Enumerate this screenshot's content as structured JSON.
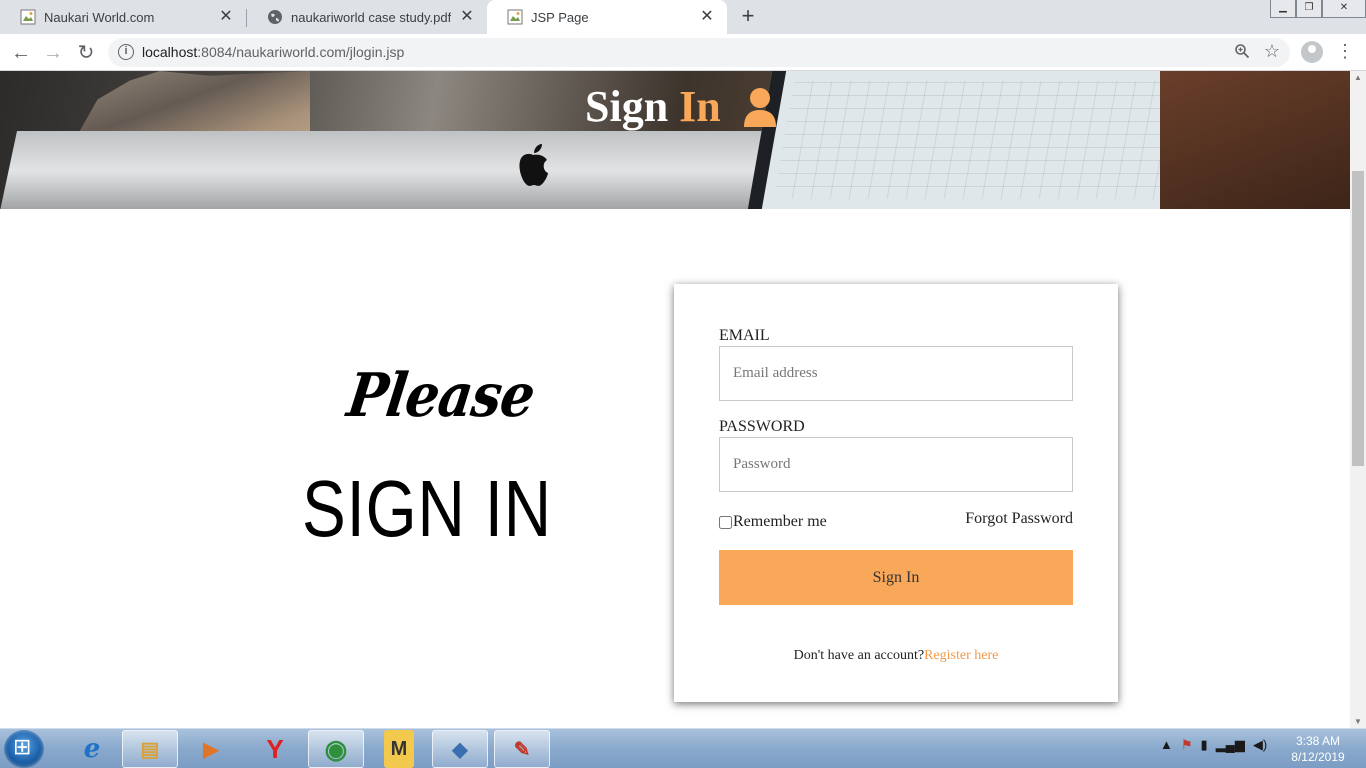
{
  "browser": {
    "tabs": [
      {
        "title": "Naukari World.com",
        "favicon": "broken-image-icon",
        "active": false
      },
      {
        "title": "naukariworld case study.pdf",
        "favicon": "globe-icon",
        "active": false
      },
      {
        "title": "JSP Page",
        "favicon": "broken-image-icon",
        "active": true
      }
    ],
    "new_tab_glyph": "+",
    "url_host": "localhost",
    "url_rest": ":8084/naukariworld.com/jlogin.jsp",
    "window_controls": [
      "minimize",
      "restore",
      "close"
    ]
  },
  "page": {
    "hero": {
      "title_part1": "Sign",
      "title_part2": "In",
      "accent_color": "#f8a858"
    },
    "left_panel": {
      "please_text": "Please",
      "signin_text": "SIGN IN"
    },
    "login_form": {
      "email_label": "EMAIL",
      "email_placeholder": "Email address",
      "email_value": "",
      "password_label": "PASSWORD",
      "password_placeholder": "Password",
      "password_value": "",
      "remember_label": "Remember me",
      "remember_checked": false,
      "forgot_label": "Forgot Password",
      "submit_label": "Sign In",
      "no_account_text": "Don't have an account?",
      "register_link": "Register here",
      "button_color": "#f8a858"
    }
  },
  "taskbar": {
    "items": [
      {
        "name": "internet-explorer-icon",
        "glyph": "e"
      },
      {
        "name": "file-explorer-icon",
        "glyph": "▤"
      },
      {
        "name": "media-player-icon",
        "glyph": "▶"
      },
      {
        "name": "yandex-browser-icon",
        "glyph": "Y"
      },
      {
        "name": "chrome-icon",
        "glyph": "◉"
      },
      {
        "name": "ms-tc-icon",
        "glyph": "M"
      },
      {
        "name": "virtualbox-icon",
        "glyph": "◆"
      },
      {
        "name": "paint-icon",
        "glyph": "✎"
      }
    ],
    "time": "3:38 AM",
    "date": "8/12/2019"
  }
}
